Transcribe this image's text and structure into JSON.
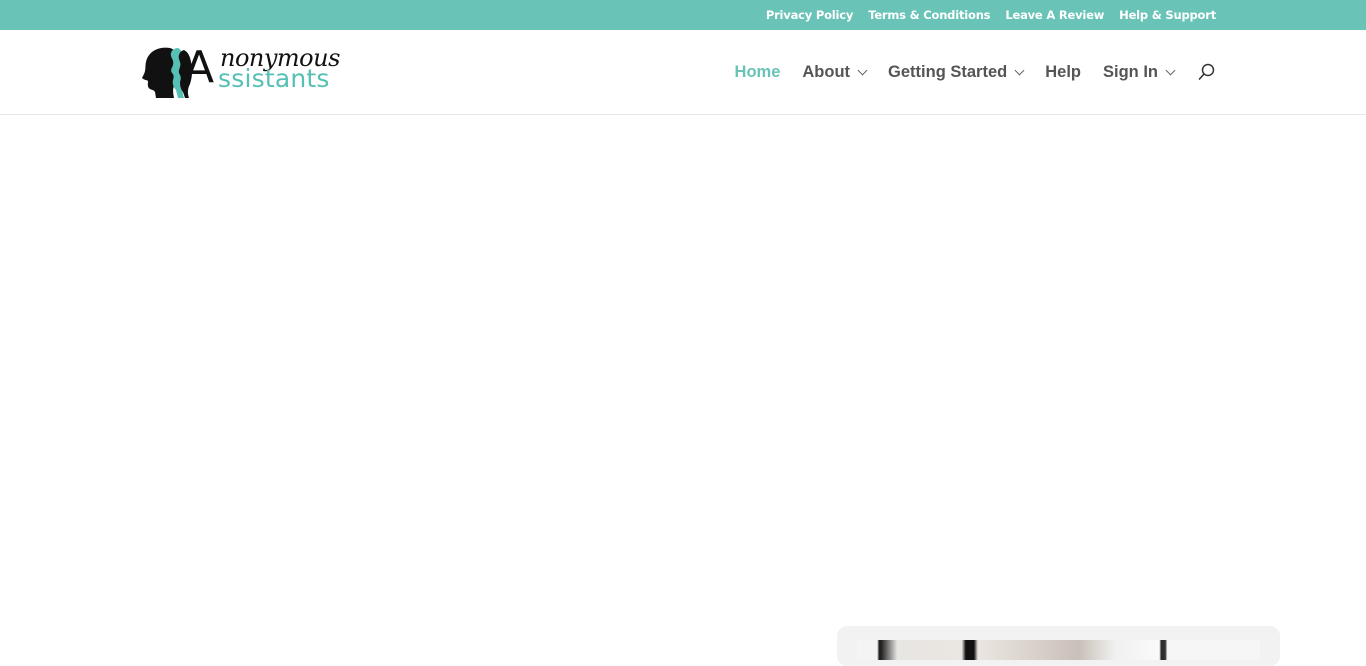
{
  "topbar": {
    "links": [
      "Privacy Policy",
      "Terms & Conditions",
      "Leave A Review",
      "Help & Support"
    ]
  },
  "brand": {
    "name_top": "nonymous",
    "name_bottom": "ssistants",
    "initial": "A",
    "accent": "#69c3b7"
  },
  "nav": {
    "items": [
      {
        "label": "Home",
        "active": true,
        "dropdown": false
      },
      {
        "label": "About",
        "active": false,
        "dropdown": true
      },
      {
        "label": "Getting Started",
        "active": false,
        "dropdown": true
      },
      {
        "label": "Help",
        "active": false,
        "dropdown": false
      },
      {
        "label": "Sign In",
        "active": false,
        "dropdown": true
      }
    ],
    "search_icon": "search-icon"
  },
  "colors": {
    "topbar_bg": "#69c3b7",
    "nav_active": "#69c3b7",
    "nav_text": "#555555"
  }
}
